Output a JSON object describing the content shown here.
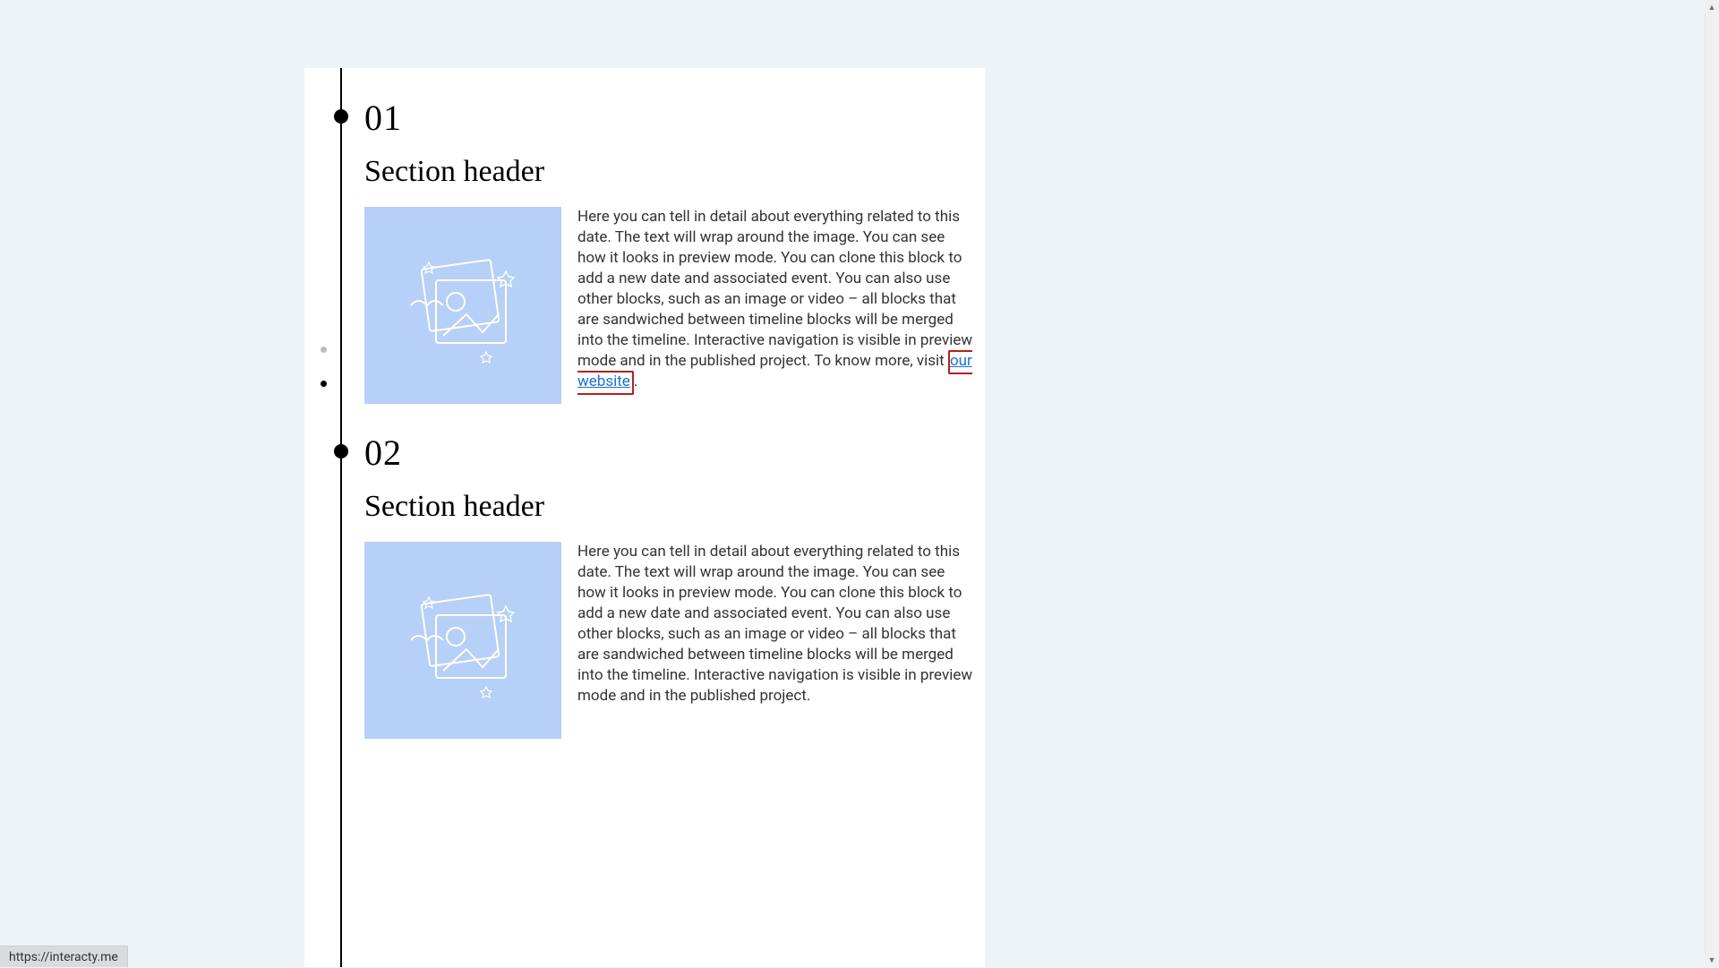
{
  "nav_dots": [
    {
      "active": false
    },
    {
      "active": true
    }
  ],
  "sections": [
    {
      "number": "01",
      "header": "Section header",
      "body_pre": "Here you can tell in detail about everything related to this date. The text will wrap around the image. You can see how it looks in preview mode. You can clone this block to add a new date and associated event. You can also use other blocks, such as an image or video – all blocks that are sandwiched between timeline blocks will be merged into the timeline. Interactive navigation is visible in preview mode and in the published project. To know more, visit ",
      "link_text": "our website",
      "body_post": "."
    },
    {
      "number": "02",
      "header": "Section header",
      "body_pre": "Here you can tell in detail about everything related to this date. The text will wrap around the image. You can see how it looks in preview mode. You can clone this block to add a new date and associated event. You can also use other blocks, such as an image or video – all blocks that are sandwiched between timeline blocks will be merged into the timeline. Interactive navigation is visible in preview mode and in the published project.",
      "link_text": "",
      "body_post": ""
    }
  ],
  "status_url": "https://interacty.me"
}
